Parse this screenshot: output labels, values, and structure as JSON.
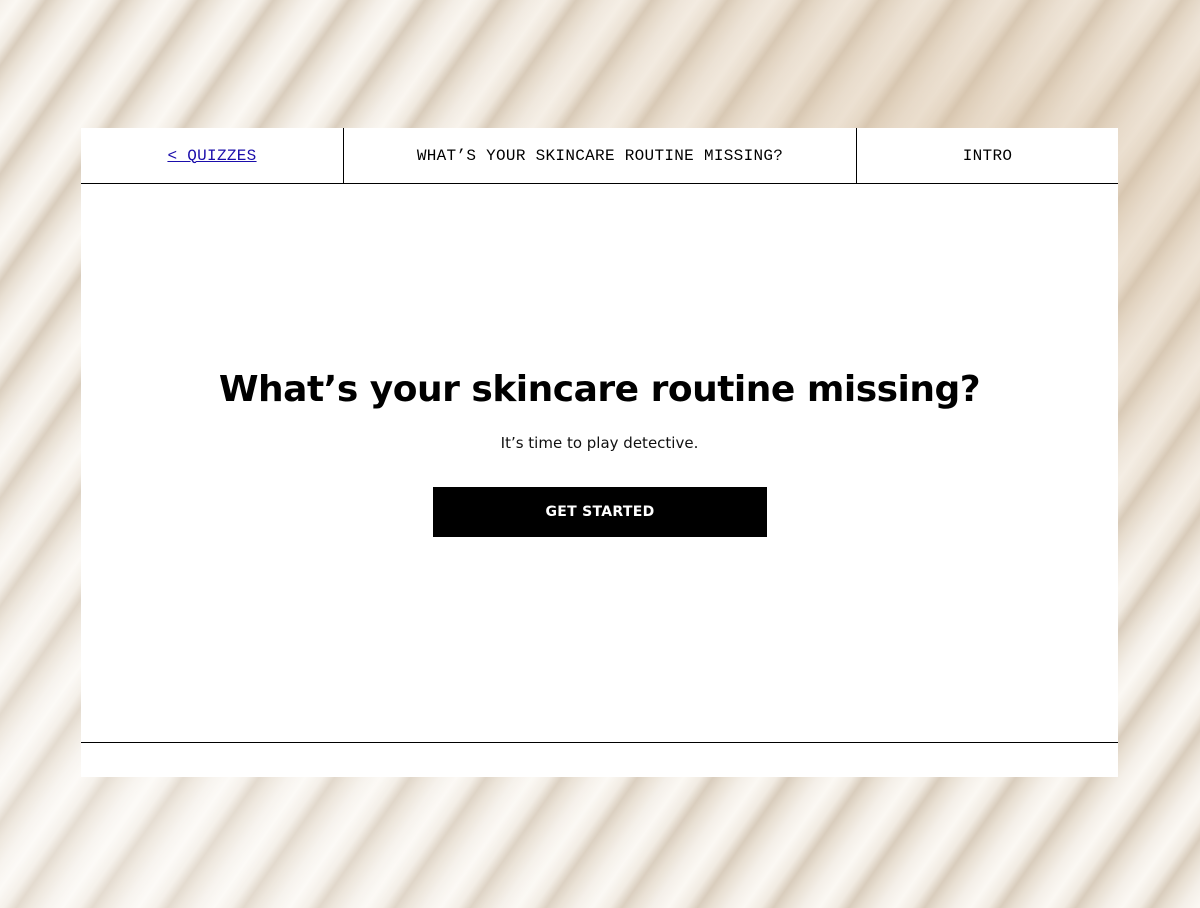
{
  "topbar": {
    "back_label": "< QUIZZES",
    "quiz_title": "WHAT’S YOUR SKINCARE ROUTINE MISSING?",
    "step_label": "INTRO"
  },
  "main": {
    "heading": "What’s your skincare routine missing?",
    "subtitle": "It’s time to play detective.",
    "cta_label": "GET STARTED"
  },
  "colors": {
    "link": "#1a0dab",
    "button_bg": "#000000",
    "button_text": "#ffffff",
    "card_bg": "#ffffff"
  }
}
